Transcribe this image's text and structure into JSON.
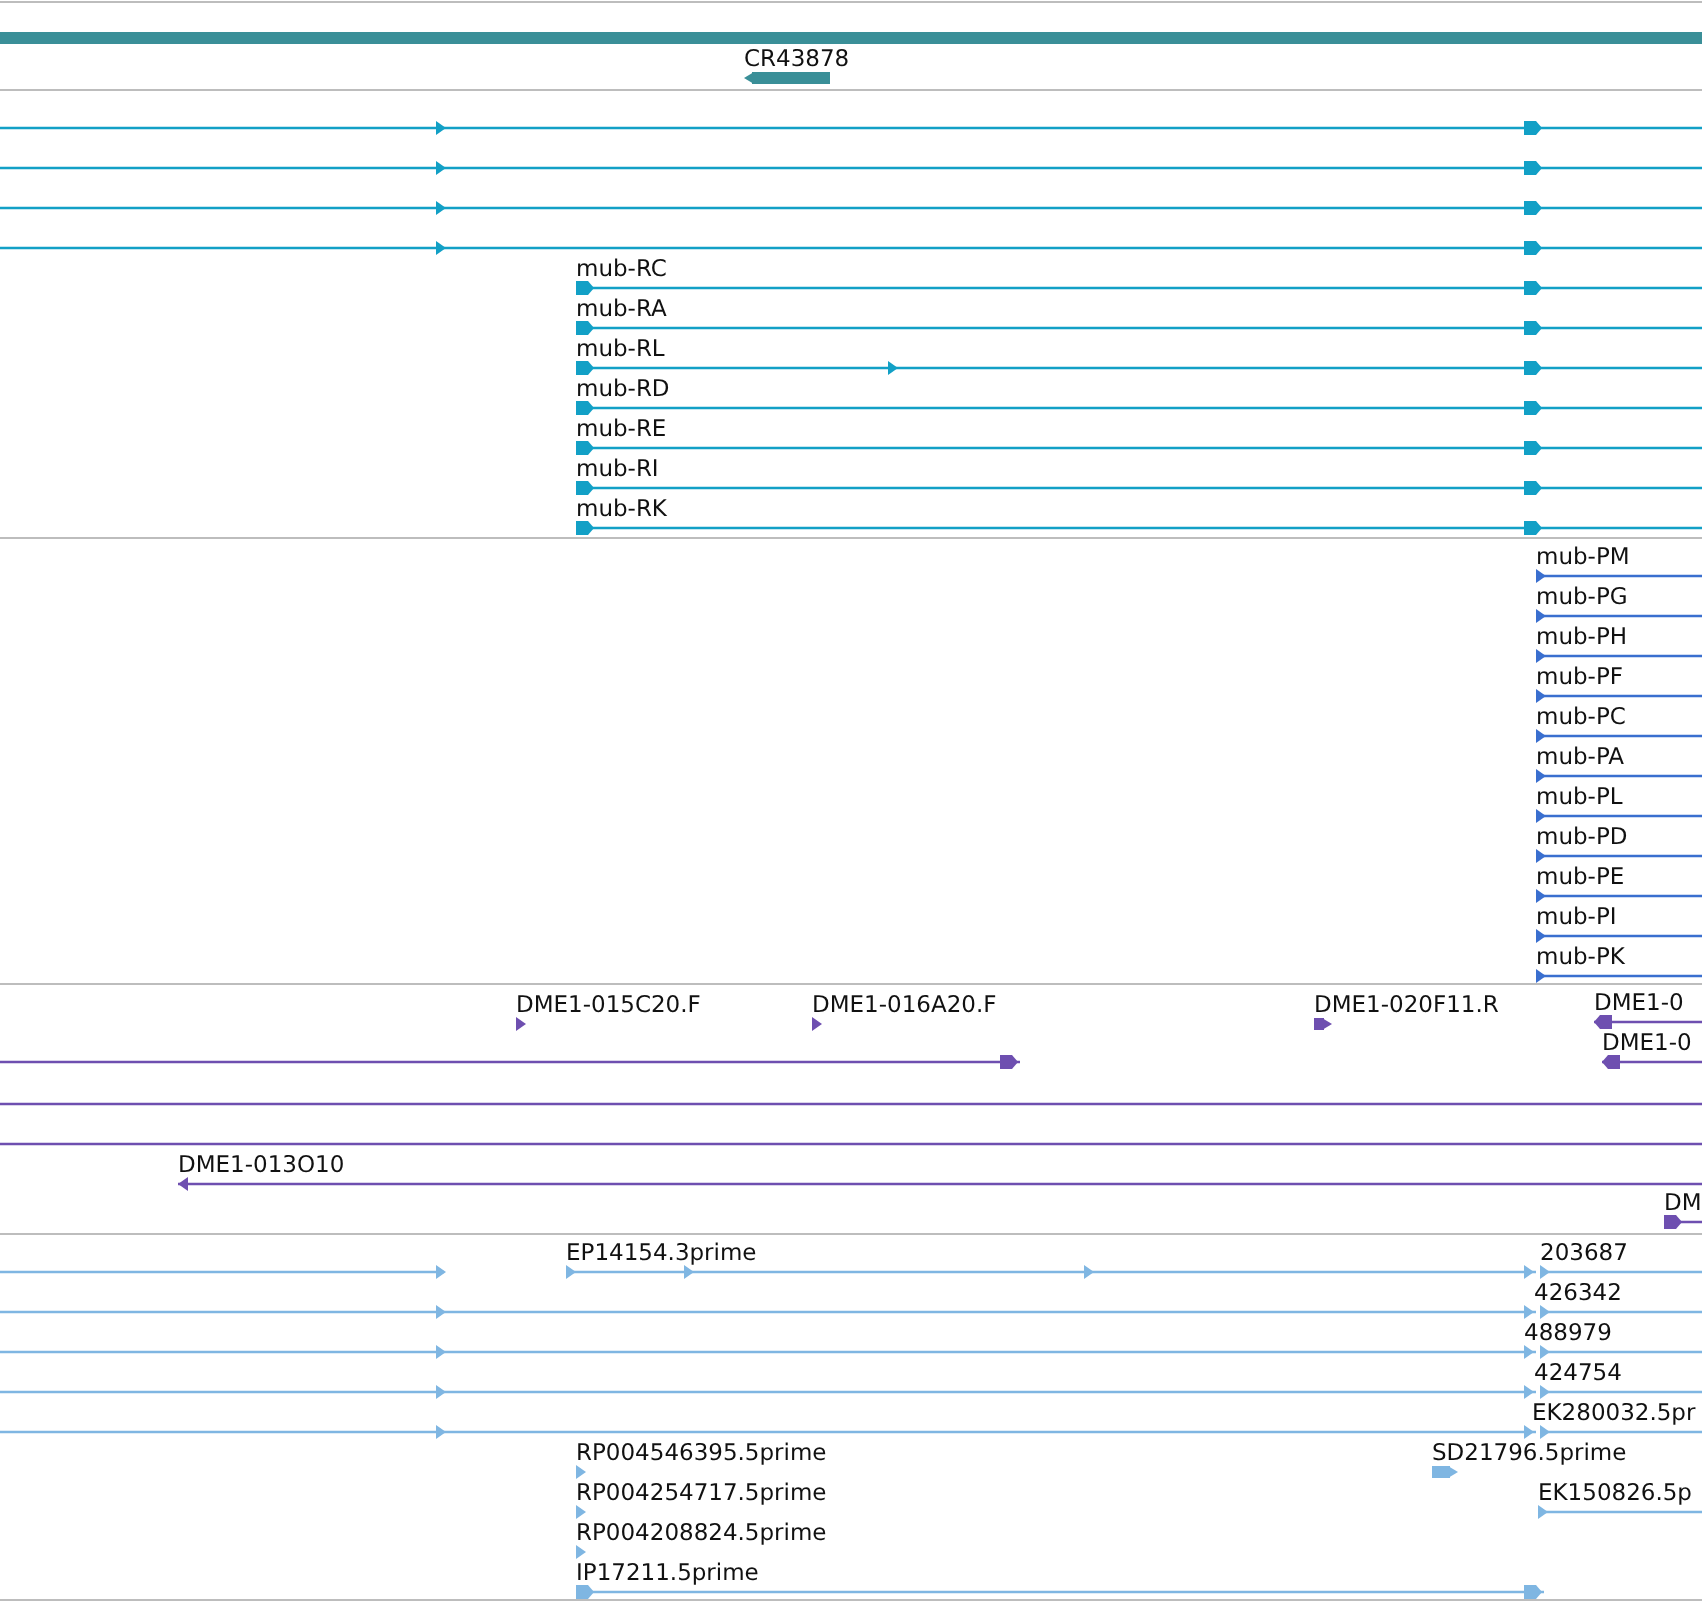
{
  "tracks": [
    {
      "kind": "gene",
      "features": [
        {
          "kind": "band"
        },
        {
          "kind": "block",
          "reverse": true,
          "label": "CR43878"
        }
      ]
    },
    {
      "kind": "transcript",
      "features": [
        {
          "kind": "line",
          "reverse": false
        },
        {
          "kind": "line",
          "reverse": false
        },
        {
          "kind": "line",
          "reverse": false
        },
        {
          "kind": "line",
          "reverse": false
        },
        {
          "kind": "line",
          "reverse": false,
          "label": "mub-RC"
        },
        {
          "kind": "line",
          "reverse": false,
          "label": "mub-RA"
        },
        {
          "kind": "line",
          "reverse": false,
          "label": "mub-RL"
        },
        {
          "kind": "line",
          "reverse": false,
          "label": "mub-RD"
        },
        {
          "kind": "line",
          "reverse": false,
          "label": "mub-RE"
        },
        {
          "kind": "line",
          "reverse": false,
          "label": "mub-RI"
        },
        {
          "kind": "line",
          "reverse": false,
          "label": "mub-RK"
        }
      ]
    },
    {
      "kind": "protein",
      "features": [
        {
          "kind": "line",
          "reverse": false,
          "label": "mub-PM"
        },
        {
          "kind": "line",
          "reverse": false,
          "label": "mub-PG"
        },
        {
          "kind": "line",
          "reverse": false,
          "label": "mub-PH"
        },
        {
          "kind": "line",
          "reverse": false,
          "label": "mub-PF"
        },
        {
          "kind": "line",
          "reverse": false,
          "label": "mub-PC"
        },
        {
          "kind": "line",
          "reverse": false,
          "label": "mub-PA"
        },
        {
          "kind": "line",
          "reverse": false,
          "label": "mub-PL"
        },
        {
          "kind": "line",
          "reverse": false,
          "label": "mub-PD"
        },
        {
          "kind": "line",
          "reverse": false,
          "label": "mub-PE"
        },
        {
          "kind": "line",
          "reverse": false,
          "label": "mub-PI"
        },
        {
          "kind": "line",
          "reverse": false,
          "label": "mub-PK"
        }
      ]
    },
    {
      "kind": "clone",
      "features": [
        {
          "kind": "tick",
          "reverse": false,
          "label": "DME1-015C20.F"
        },
        {
          "kind": "tick",
          "reverse": false,
          "label": "DME1-016A20.F"
        },
        {
          "kind": "block",
          "reverse": false,
          "label": "DME1-020F11.R"
        },
        {
          "kind": "line",
          "reverse": true,
          "label": "DME1-0"
        },
        {
          "kind": "line",
          "reverse": false
        },
        {
          "kind": "line",
          "reverse": true,
          "label": "DME1-0"
        },
        {
          "kind": "line"
        },
        {
          "kind": "line"
        },
        {
          "kind": "line",
          "reverse": true,
          "label": "DME1-013O10"
        },
        {
          "kind": "line",
          "reverse": false,
          "label": "DM"
        }
      ]
    },
    {
      "kind": "est",
      "features": [
        {
          "kind": "line",
          "reverse": false
        },
        {
          "kind": "line",
          "reverse": false,
          "label": "EP14154.3prime"
        },
        {
          "kind": "line",
          "reverse": false,
          "label": "203687"
        },
        {
          "kind": "line",
          "reverse": false
        },
        {
          "kind": "line",
          "reverse": false,
          "label": "426342"
        },
        {
          "kind": "line",
          "reverse": false
        },
        {
          "kind": "line",
          "reverse": false,
          "label": "488979"
        },
        {
          "kind": "line",
          "reverse": false
        },
        {
          "kind": "line",
          "reverse": false,
          "label": "424754"
        },
        {
          "kind": "line",
          "reverse": false
        },
        {
          "kind": "line",
          "reverse": false,
          "label": "EK280032.5pr"
        },
        {
          "kind": "tick",
          "reverse": false,
          "label": "RP004546395.5prime"
        },
        {
          "kind": "block",
          "reverse": false,
          "label": "SD21796.5prime"
        },
        {
          "kind": "tick",
          "reverse": false,
          "label": "RP004254717.5prime"
        },
        {
          "kind": "line",
          "reverse": false,
          "label": "EK150826.5p"
        },
        {
          "kind": "tick",
          "reverse": false,
          "label": "RP004208824.5prime"
        },
        {
          "kind": "line",
          "reverse": false,
          "label": "IP17211.5prime"
        }
      ]
    }
  ]
}
